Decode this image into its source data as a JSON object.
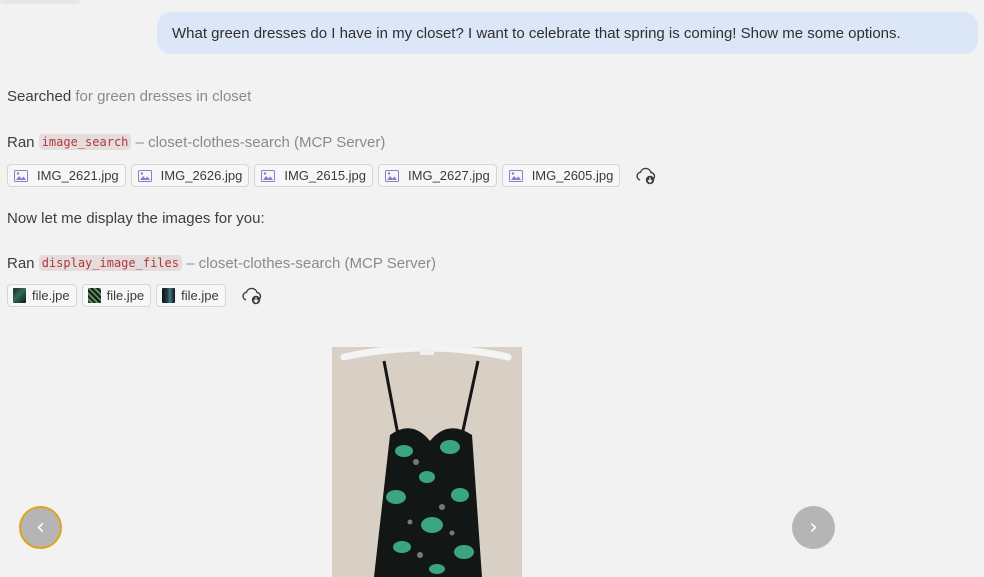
{
  "user_message": "What green dresses do I have in my closet? I want to celebrate that spring is coming! Show me some options.",
  "search_step": {
    "verb": "Searched",
    "detail": "for green dresses in closet"
  },
  "tool_call_1": {
    "prefix": "Ran",
    "tool": "image_search",
    "suffix": "– closet-clothes-search (MCP Server)",
    "files": [
      "IMG_2621.jpg",
      "IMG_2626.jpg",
      "IMG_2615.jpg",
      "IMG_2627.jpg",
      "IMG_2605.jpg"
    ]
  },
  "assistant_text": "Now let me display the images for you:",
  "tool_call_2": {
    "prefix": "Ran",
    "tool": "display_image_files",
    "suffix": "– closet-clothes-search (MCP Server)",
    "files": [
      "file.jpe",
      "file.jpe",
      "file.jpe"
    ]
  },
  "carousel": {
    "prev": "‹",
    "next": "›"
  },
  "icons": {
    "image_file": "image-file-icon",
    "download": "cloud-download-icon"
  },
  "colors": {
    "user_bubble": "#dbe7f7",
    "code_text": "#b23838",
    "focus_ring": "#e0a321"
  }
}
